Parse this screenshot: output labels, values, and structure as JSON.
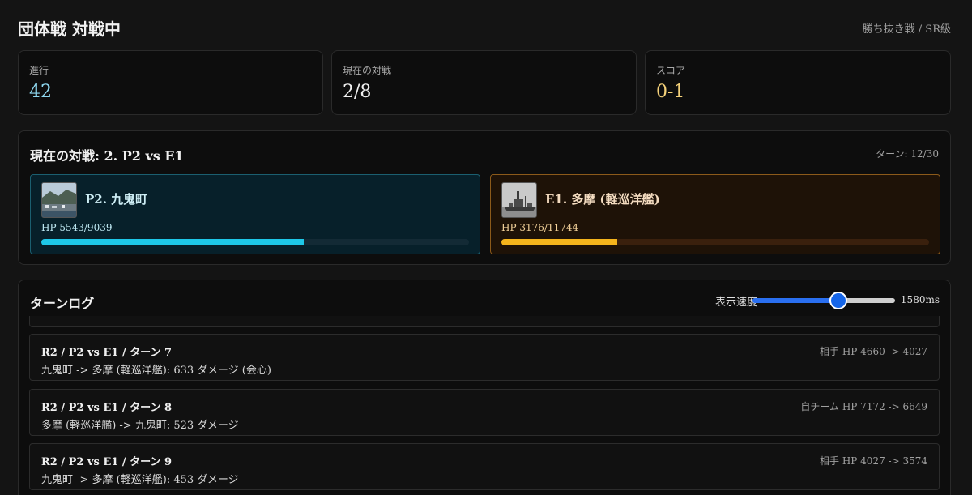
{
  "header": {
    "title": "団体戦 対戦中",
    "mode": "勝ち抜き戦 / SR級"
  },
  "stats": [
    {
      "label": "進行",
      "value": "42",
      "color": "#8fd8f0"
    },
    {
      "label": "現在の対戦",
      "value": "2/8",
      "color": "#f0f0f0"
    },
    {
      "label": "スコア",
      "value": "0-1",
      "color": "#f5d27a"
    }
  ],
  "match": {
    "title": "現在の対戦: 2. P2 vs E1",
    "turn": "ターン: 12/30",
    "player": {
      "name": "P2. 九鬼町",
      "hp_text": "HP 5543/9039",
      "hp_fraction": 0.613,
      "image": "harbor-town-photo"
    },
    "enemy": {
      "name": "E1. 多摩 (軽巡洋艦)",
      "hp_text": "HP 3176/11744",
      "hp_fraction": 0.27,
      "image": "cruiser-warship-photo"
    }
  },
  "log": {
    "title": "ターンログ",
    "speed_label": "表示速度",
    "speed_value": "1580ms",
    "speed_fraction": 0.6,
    "entries": [
      {
        "head": "R2 / P2 vs E1 / ターン 7",
        "hp": "相手 HP 4660 -> 4027",
        "detail": "九鬼町 -> 多摩 (軽巡洋艦): 633 ダメージ (会心)"
      },
      {
        "head": "R2 / P2 vs E1 / ターン 8",
        "hp": "自チーム HP 7172 -> 6649",
        "detail": "多摩 (軽巡洋艦) -> 九鬼町: 523 ダメージ"
      },
      {
        "head": "R2 / P2 vs E1 / ターン 9",
        "hp": "相手 HP 4027 -> 3574",
        "detail": "九鬼町 -> 多摩 (軽巡洋艦): 453 ダメージ"
      }
    ]
  }
}
